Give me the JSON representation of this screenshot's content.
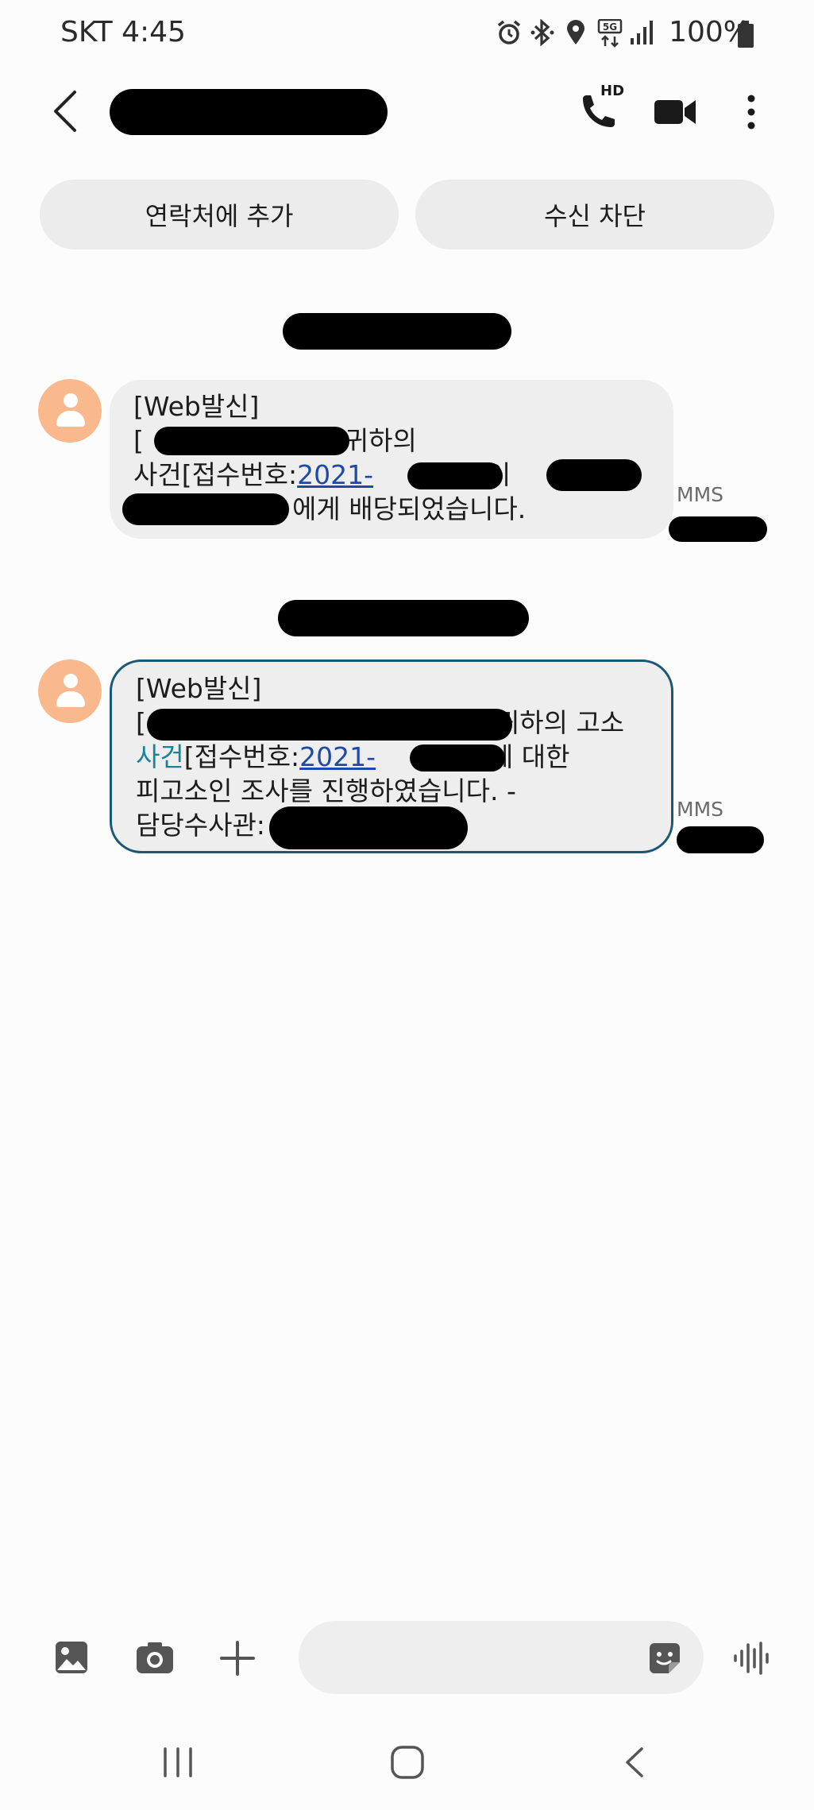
{
  "status_bar": {
    "carrier_time": "SKT 4:45",
    "battery": "100%",
    "icons": [
      "alarm-icon",
      "bluetooth-icon",
      "location-icon",
      "5g-icon",
      "signal-icon",
      "battery-icon"
    ]
  },
  "header": {
    "icons": [
      "back-icon",
      "hd-voice-call-icon",
      "video-call-icon",
      "more-options-icon"
    ],
    "call_badge": "HD"
  },
  "actions": {
    "add_contact": "연락처에 추가",
    "block": "수신 차단"
  },
  "messages": [
    {
      "prefix": "[Web발신]",
      "line2_suffix": "]귀하의",
      "line3_a": "사건[접수번호:",
      "line3_link": "2021-",
      "line3_b": "]이",
      "line4_suffix": "에게 배당되었습니다.",
      "type_label": "MMS"
    },
    {
      "prefix": "[Web발신]",
      "line2_suffix": "귀하의 고소",
      "line3_hl": "사건",
      "line3_a": "[접수번호:",
      "line3_link": "2021-",
      "line3_b": "]에 대한",
      "line4": "피고소인 조사를 진행하였습니다. -",
      "line5": "담당수사관:",
      "type_label": "MMS"
    }
  ],
  "composer": {
    "icons": [
      "gallery-icon",
      "camera-icon",
      "plus-icon",
      "sticker-icon",
      "voice-record-icon"
    ]
  },
  "navigation": {
    "icons": [
      "recent-apps-icon",
      "home-icon",
      "back-nav-icon"
    ]
  },
  "colors": {
    "avatar": "#f9b98c",
    "link": "#1d49a8",
    "highlight": "#17839a",
    "selected_border": "#1c5677",
    "bubble_bg": "#eeeeee"
  }
}
